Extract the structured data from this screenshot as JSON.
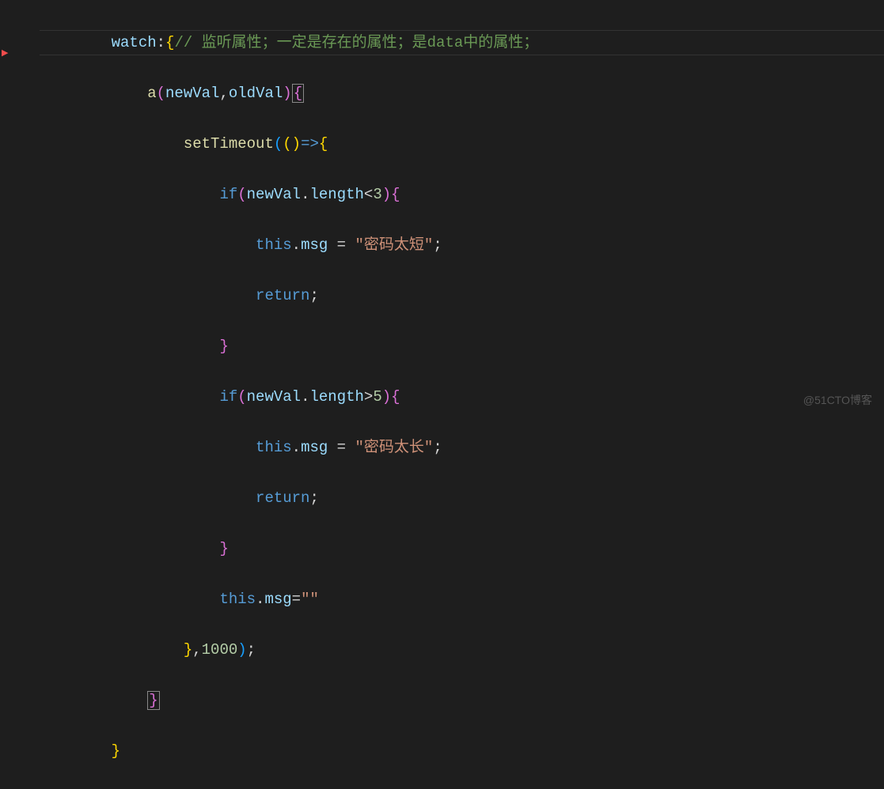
{
  "code": {
    "line1": {
      "watch": "watch",
      "colon": ":",
      "brace": "{",
      "comment": "// 监听属性；一定是存在的属性；是data中的属性；"
    },
    "line2": {
      "func": "a",
      "open": "(",
      "param1": "newVal",
      "comma": ",",
      "param2": "oldVal",
      "close": ")",
      "brace": "{"
    },
    "line3": {
      "func": "setTimeout",
      "open1": "(",
      "open2": "(",
      "close2": ")",
      "arrow": "=>",
      "brace": "{"
    },
    "line4": {
      "if": "if",
      "open": "(",
      "var": "newVal",
      "dot": ".",
      "prop": "length",
      "op": "<",
      "num": "3",
      "close": ")",
      "brace": "{"
    },
    "line5": {
      "this": "this",
      "dot": ".",
      "prop": "msg",
      "eq": " = ",
      "str": "\"密码太短\"",
      "semi": ";"
    },
    "line6": {
      "return": "return",
      "semi": ";"
    },
    "line7": {
      "brace": "}"
    },
    "line8": {
      "if": "if",
      "open": "(",
      "var": "newVal",
      "dot": ".",
      "prop": "length",
      "op": ">",
      "num": "5",
      "close": ")",
      "brace": "{"
    },
    "line9": {
      "this": "this",
      "dot": ".",
      "prop": "msg",
      "eq": " = ",
      "str": "\"密码太长\"",
      "semi": ";"
    },
    "line10": {
      "return": "return",
      "semi": ";"
    },
    "line11": {
      "brace": "}"
    },
    "line12": {
      "this": "this",
      "dot": ".",
      "prop": "msg",
      "eq": "=",
      "str": "\"\""
    },
    "line13": {
      "brace": "}",
      "comma": ",",
      "num": "1000",
      "close": ")",
      "semi": ";"
    },
    "line14": {
      "brace": "}"
    },
    "line15": {
      "brace": "}"
    }
  },
  "watermark": "@51CTO博客"
}
